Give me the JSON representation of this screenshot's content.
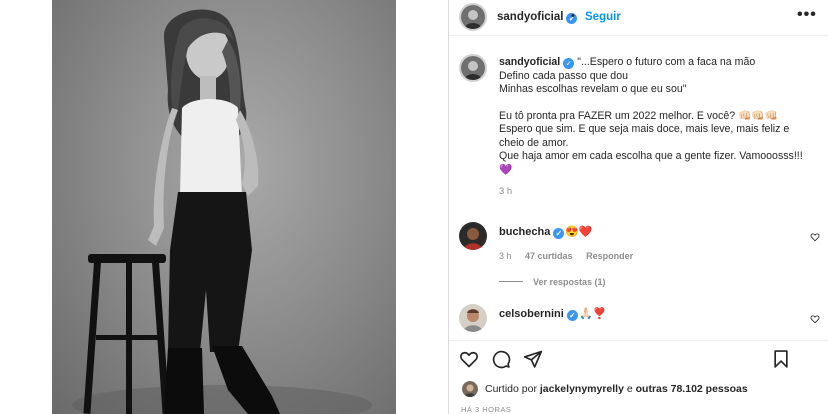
{
  "post": {
    "username": "sandyoficial",
    "follow_label": "Seguir",
    "more_label": "•••",
    "dot": "•"
  },
  "caption": {
    "username": "sandyoficial",
    "lines": [
      "\"...Espero o futuro com a faca na mão",
      "Defino cada passo que dou",
      "Minhas escolhas revelam o que eu sou\"",
      "",
      "Eu tô pronta pra FAZER um 2022 melhor. E você? 👊🏻👊🏻👊🏻",
      "Espero que sim. E que seja mais doce, mais leve, mais feliz e",
      "cheio de amor.",
      "Que haja amor em cada escolha que a gente fizer. Vamooosss!!!",
      "💜"
    ],
    "time": "3 h"
  },
  "comments": [
    {
      "username": "buchecha",
      "text": "😍❤️",
      "time": "3 h",
      "likes": "47 curtidas",
      "reply": "Responder",
      "view_replies": "Ver respostas (1)"
    },
    {
      "username": "celsobernini",
      "text": "🙏🏻❣️"
    }
  ],
  "footer": {
    "liked_prefix": "Curtido por",
    "liked_user": "jackelynymyrelly",
    "liked_middle": "e",
    "liked_others": "outras 78.102 pessoas",
    "time_ago": "HÁ 3 HORAS"
  },
  "colors": {
    "link": "#0095f6",
    "verified": "#3897f0",
    "muted": "#8e8e8e",
    "text": "#262626",
    "emoji_heart": "#ed4956"
  },
  "icons": [
    "heart-icon",
    "comment-icon",
    "share-icon",
    "bookmark-icon",
    "verified-icon",
    "more-icon"
  ]
}
